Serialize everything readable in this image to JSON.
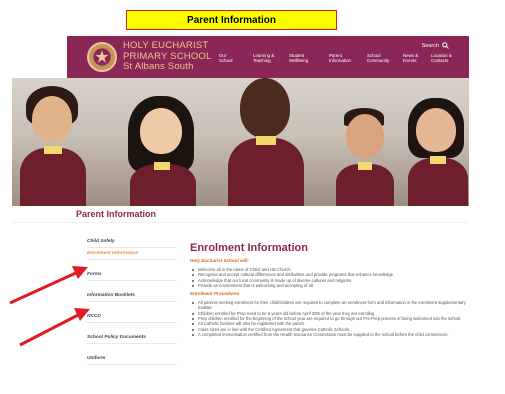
{
  "annotation": {
    "label": "Parent Information"
  },
  "header": {
    "school_name": [
      "HOLY EUCHARIST",
      "PRIMARY SCHOOL",
      "St Albans South"
    ],
    "nav": [
      "Our\nSchool",
      "Learning &\nTeaching",
      "Student\nWellbeing",
      "Parent\nInformation",
      "School\nCommunity",
      "News &\nEvents",
      "Location &\nContacts"
    ],
    "search_label": "Search"
  },
  "page_title": "Parent Information",
  "sidebar": {
    "items": [
      {
        "label": "Child Safety",
        "active": false
      },
      {
        "label": "Enrolment Information",
        "active": true
      },
      {
        "label": "Forms",
        "active": false
      },
      {
        "label": "Information Booklets",
        "active": false
      },
      {
        "label": "NCCD",
        "active": false
      },
      {
        "label": "School Policy Documents",
        "active": false
      },
      {
        "label": "Uniform",
        "active": false
      }
    ]
  },
  "content": {
    "heading": "Enrolment Information",
    "section1_title": "Holy Eucharist School will:",
    "section1_bullets": [
      "Welcome all in the name of Christ and His Church.",
      "Recognise and accept cultural differences and similarities and provide programs that enhance knowledge.",
      "Acknowledge that our local community is made up of diverse cultures and religions.",
      "Provide an environment that is welcoming and accepting of all."
    ],
    "section2_title": "Enrolment Procedures",
    "section2_bullets": [
      "All parents seeking enrolment for their child/children are required to complete an enrolment form and information in the enrolment supplementary booklet.",
      "Children enrolled for Prep need to be 5 years old before April 30th of the year they are enrolling.",
      "Prep children enrolled for the beginning of the school year are required to go through our Pre-Prep process of being welcomed into the school.",
      "All Catholic families will also be registered with the parish.",
      "Class sizes are in line with the Certified Agreement that governs Catholic Schools.",
      "A completed immunisation certified from the Health Insurance Commission must be supplied to the school before the child commences."
    ]
  },
  "colors": {
    "brand": "#8a2757",
    "gold": "#f0c48a",
    "accent_orange": "#e4923b",
    "annotation_yellow": "#ffff00",
    "annotation_red": "#d81f26"
  }
}
